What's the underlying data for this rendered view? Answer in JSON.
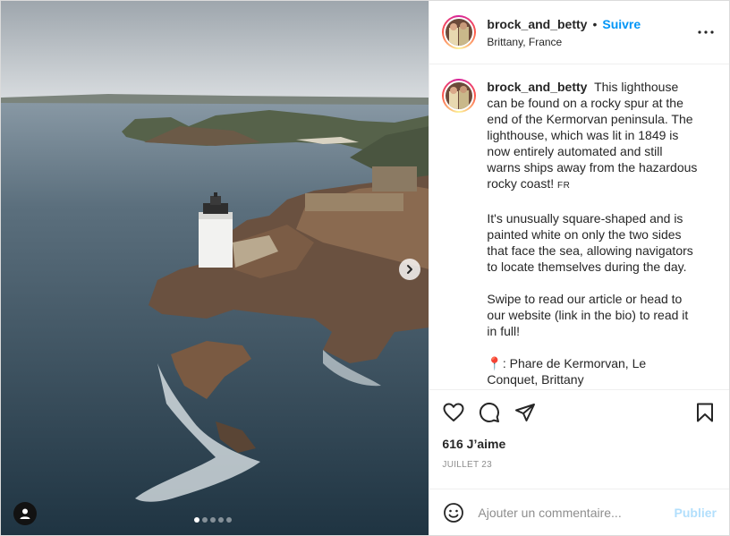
{
  "post": {
    "username": "brock_and_betty",
    "follow_label": "Suivre",
    "separator": "•",
    "location": "Brittany, France",
    "caption_paragraphs": [
      "This lighthouse can be found on a rocky spur at the end of the Kermorvan peninsula. The lighthouse, which was lit in 1849 is now entirely automated and still warns ships away from the hazardous rocky coast!",
      "It's unusually square-shaped and is painted white on only the two sides that face the sea, allowing navigators to locate themselves during the day.",
      "Swipe to read our article or head to our website (link in the bio) to read it in full!",
      "📍: Phare de Kermorvan, Le Conquet, Brittany"
    ],
    "flag_text": "FR",
    "likes": "616 J’aime",
    "date": "JUILLET 23",
    "comment_placeholder": "Ajouter un commentaire...",
    "publish_label": "Publier"
  },
  "carousel": {
    "count": 5,
    "active_index": 0
  },
  "icons": {
    "more": "more-horizontal-icon",
    "like": "heart-icon",
    "comment": "comment-bubble-icon",
    "share": "paper-plane-icon",
    "save": "bookmark-icon",
    "emoji": "smiley-icon",
    "next": "chevron-right-icon",
    "user_tag": "person-icon"
  },
  "colors": {
    "accent": "#0095f6",
    "publish_disabled": "#b2dffc",
    "muted": "#8e8e8e"
  }
}
